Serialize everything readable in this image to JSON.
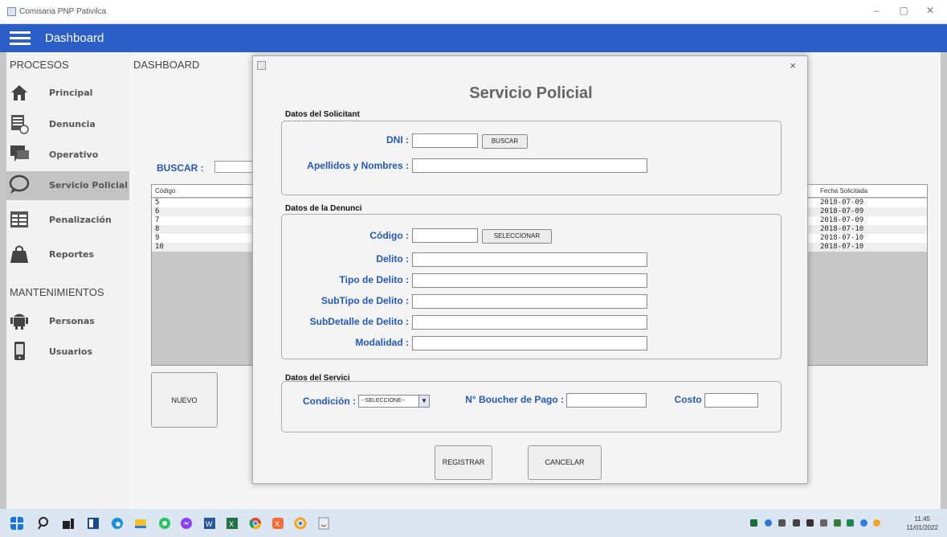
{
  "window": {
    "title": "Comisaria PNP Pativilca",
    "minimize": "–",
    "restore": "▢",
    "close": "✕"
  },
  "appbar": {
    "title": "Dashboard"
  },
  "sidebar": {
    "section_procesos": "PROCESOS",
    "section_mantenimientos": "MANTENIMIENTOS",
    "items": [
      {
        "label": "Principal",
        "icon": "home-icon"
      },
      {
        "label": "Denuncia",
        "icon": "document-clock-icon"
      },
      {
        "label": "Operativo",
        "icon": "chat-icon"
      },
      {
        "label": "Servicio Policial",
        "icon": "speech-bubble-icon",
        "active": true
      },
      {
        "label": "Penalización",
        "icon": "table-icon"
      },
      {
        "label": "Reportes",
        "icon": "bag-icon"
      },
      {
        "label": "Personas",
        "icon": "android-icon"
      },
      {
        "label": "Usuarios",
        "icon": "phone-icon"
      }
    ]
  },
  "main": {
    "label": "DASHBOARD",
    "search_label": "BUSCAR :",
    "table": {
      "headers": [
        "Código",
        "Fecha Solicitada"
      ],
      "rows": [
        [
          "5",
          "2018-07-09"
        ],
        [
          "6",
          "2018-07-09"
        ],
        [
          "7",
          "2018-07-09"
        ],
        [
          "8",
          "2018-07-10"
        ],
        [
          "9",
          "2018-07-10"
        ],
        [
          "10",
          "2018-07-10"
        ]
      ]
    },
    "new_button": "NUEVO"
  },
  "dialog": {
    "close": "×",
    "title": "Servicio Policial",
    "solicitante": {
      "title": "Datos del Solicitant",
      "dni_label": "DNI :",
      "dni_value": "",
      "search_button": "BUSCAR",
      "name_label": "Apellidos y Nombres :",
      "name_value": ""
    },
    "denuncia": {
      "title": "Datos de la Denunci",
      "codigo_label": "Código :",
      "select_button": "SELECCIONAR",
      "delito_label": "Delito :",
      "tipo_label": "Tipo de Delito :",
      "subtipo_label": "SubTipo de Delito :",
      "subdetalle_label": "SubDetalle de Delito :",
      "modalidad_label": "Modalidad :"
    },
    "servicio": {
      "title": "Datos del Servici",
      "condicion_label": "Condición :",
      "condicion_value": "--SELECCIONE--",
      "boucher_label": "N° Boucher de Pago :",
      "costo_label": "Costo :"
    },
    "register_button": "REGISTRAR",
    "cancel_button": "CANCELAR"
  },
  "taskbar": {
    "time": "11:45",
    "date": "11/01/2022"
  },
  "colors": {
    "accent_blue": "#2b5fc7",
    "label_blue": "#2458b8"
  }
}
